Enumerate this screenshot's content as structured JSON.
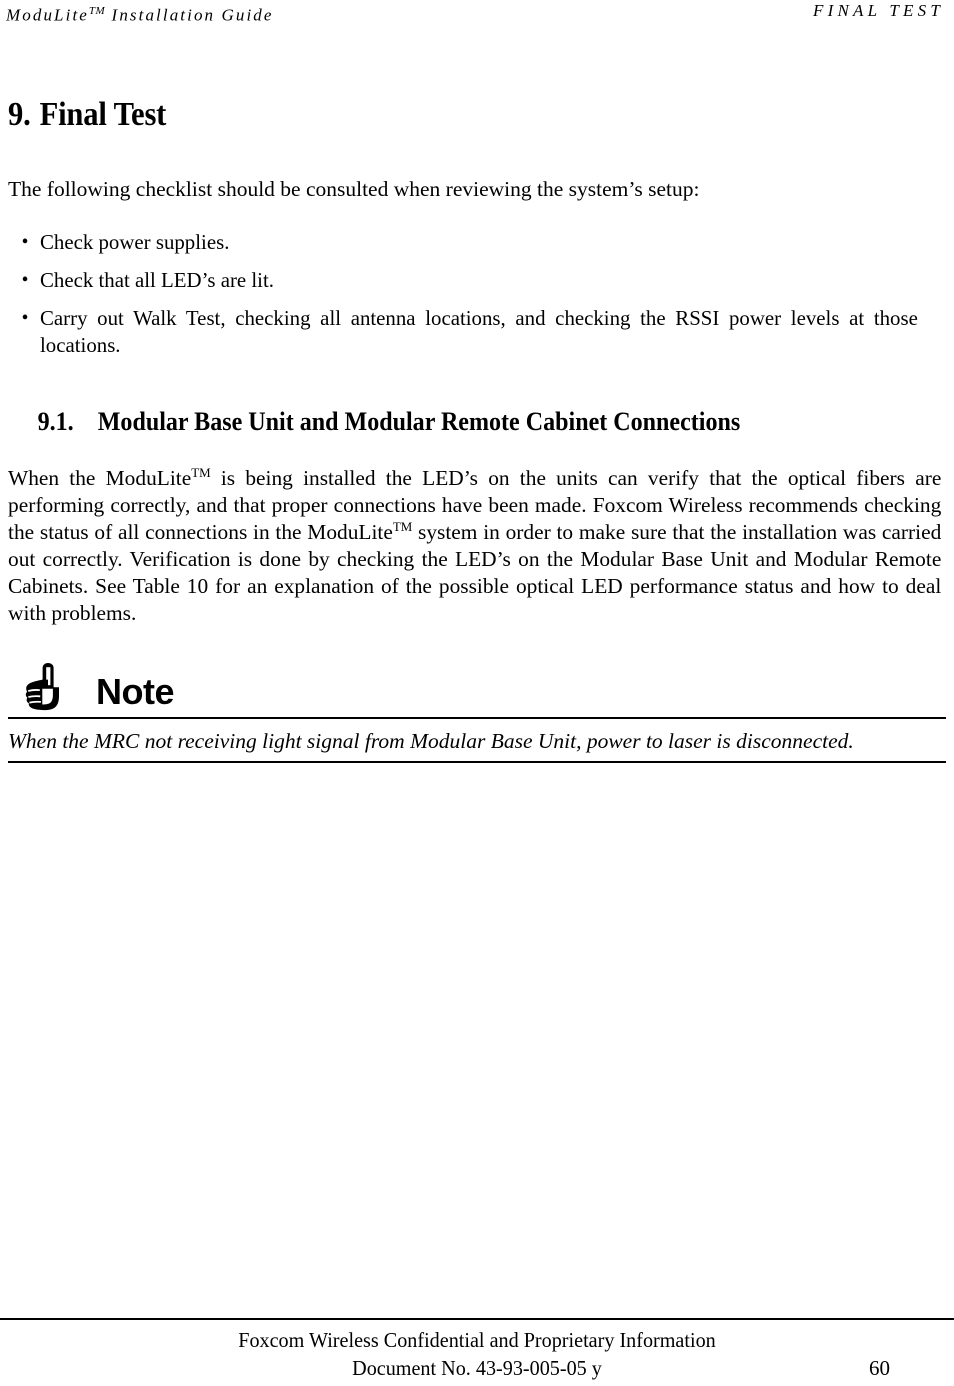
{
  "header": {
    "left_text": "ModuLite",
    "left_tm": "TM",
    "left_suffix": " Installation Guide",
    "right_text": "FINAL TEST"
  },
  "chapter": {
    "number": "9.",
    "title": "Final Test",
    "intro": "The following checklist should be consulted when reviewing the system’s setup:"
  },
  "checklist": {
    "bullet_glyph": "•",
    "items": [
      "Check power supplies.",
      "Check that all LED’s are lit.",
      "Carry out Walk Test, checking all antenna locations, and checking the RSSI power levels at those locations."
    ]
  },
  "section": {
    "number": "9.1.",
    "title": "Modular Base Unit and Modular Remote Cabinet Connections",
    "paragraph_part1": "When the ModuLite",
    "paragraph_tm1": "TM",
    "paragraph_part2": " is being installed the LED’s on the units can verify that the optical fibers are performing correctly, and that proper connections have been made. Foxcom Wireless recommends checking the status of all connections in the ModuLite",
    "paragraph_tm2": "TM",
    "paragraph_part3": " system in order to make sure that the installation was carried out correctly. Verification is done by checking the LED’s on the Modular Base Unit and Modular Remote Cabinets. See Table 10 for an explanation of the possible optical LED performance status and how to deal with problems."
  },
  "note": {
    "icon": "pointing-hand-icon",
    "label": "Note",
    "text": "When the MRC not receiving light signal from Modular Base Unit, power to laser is disconnected."
  },
  "footer": {
    "line1": "Foxcom Wireless Confidential and Proprietary Information",
    "line2": "Document No. 43-93-005-05 y",
    "page_number": "60"
  },
  "colors": {
    "text": "#000000",
    "background": "#ffffff",
    "rule": "#000000"
  }
}
